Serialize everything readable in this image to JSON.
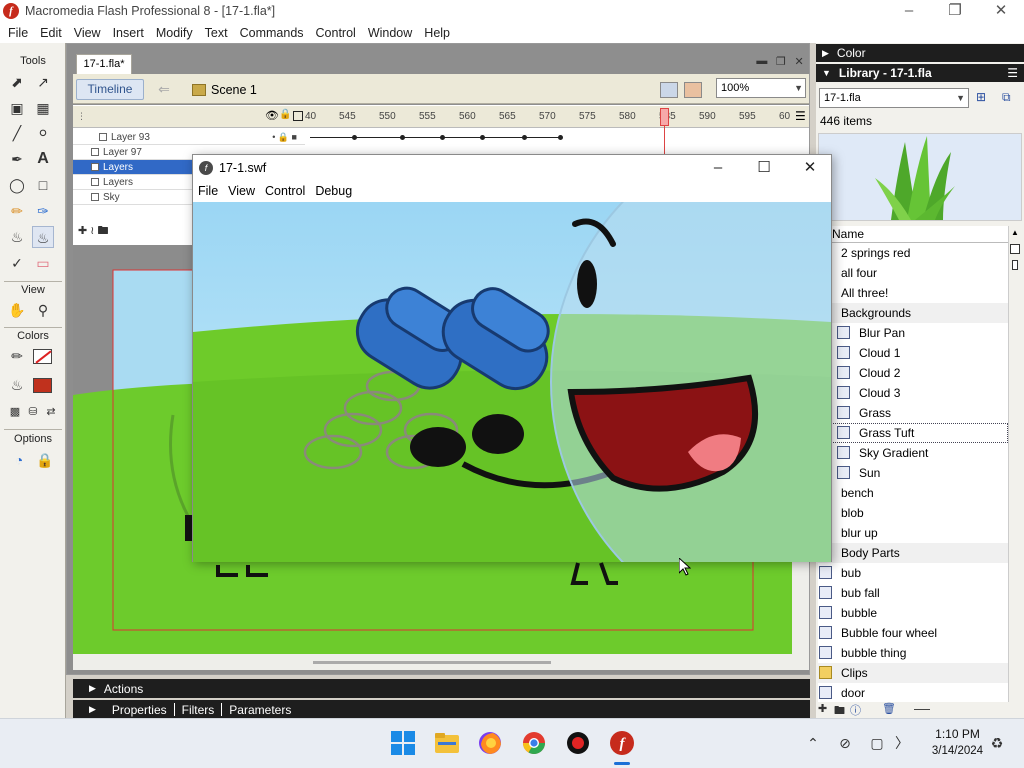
{
  "window": {
    "title": "Macromedia Flash Professional 8 - [17-1.fla*]"
  },
  "menubar": [
    "File",
    "Edit",
    "View",
    "Insert",
    "Modify",
    "Text",
    "Commands",
    "Control",
    "Window",
    "Help"
  ],
  "tools": {
    "tools_label": "Tools",
    "view_label": "View",
    "colors_label": "Colors",
    "options_label": "Options"
  },
  "document": {
    "tab": "17-1.fla*",
    "timeline_button": "Timeline",
    "scene": "Scene 1",
    "zoom": "100%"
  },
  "timeline": {
    "ruler": [
      "40",
      "545",
      "550",
      "555",
      "560",
      "565",
      "570",
      "575",
      "580",
      "585",
      "590",
      "595",
      "60"
    ],
    "layers": [
      "Layer 93",
      "Layer 97",
      "Layers",
      "Layers",
      "Sky"
    ],
    "selected_layer_index": 2
  },
  "panels": {
    "actions": "Actions",
    "properties": "Properties",
    "filters": "Filters",
    "parameters": "Parameters"
  },
  "right": {
    "color_header": "Color",
    "library_header": "Library - 17-1.fla",
    "library_select": "17-1.fla",
    "item_count": "446 items",
    "name_column": "Name"
  },
  "library_items": [
    {
      "name": "2 springs red",
      "kind": "symbol",
      "indent": 0
    },
    {
      "name": "all four",
      "kind": "symbol",
      "indent": 0
    },
    {
      "name": "All three!",
      "kind": "symbol",
      "indent": 0
    },
    {
      "name": "Backgrounds",
      "kind": "folder",
      "indent": 0
    },
    {
      "name": "Blur Pan",
      "kind": "symbol",
      "indent": 1
    },
    {
      "name": "Cloud 1",
      "kind": "symbol",
      "indent": 1
    },
    {
      "name": "Cloud 2",
      "kind": "symbol",
      "indent": 1
    },
    {
      "name": "Cloud 3",
      "kind": "symbol",
      "indent": 1
    },
    {
      "name": "Grass",
      "kind": "symbol",
      "indent": 1
    },
    {
      "name": "Grass Tuft",
      "kind": "symbol",
      "indent": 1
    },
    {
      "name": "Sky Gradient",
      "kind": "symbol",
      "indent": 1
    },
    {
      "name": "Sun",
      "kind": "symbol",
      "indent": 1
    },
    {
      "name": "bench",
      "kind": "symbol",
      "indent": 0
    },
    {
      "name": "blob",
      "kind": "symbol",
      "indent": 0
    },
    {
      "name": "blur up",
      "kind": "symbol",
      "indent": 0
    },
    {
      "name": "Body Parts",
      "kind": "folder",
      "indent": 0
    },
    {
      "name": "bub",
      "kind": "symbol",
      "indent": 0
    },
    {
      "name": "bub fall",
      "kind": "symbol",
      "indent": 0
    },
    {
      "name": "bubble",
      "kind": "symbol",
      "indent": 0
    },
    {
      "name": "Bubble four wheel",
      "kind": "symbol",
      "indent": 0
    },
    {
      "name": "bubble thing",
      "kind": "symbol",
      "indent": 0
    },
    {
      "name": "Clips",
      "kind": "folder",
      "indent": 0
    },
    {
      "name": "door",
      "kind": "symbol",
      "indent": 0
    }
  ],
  "highlighted_item": "Grass Tuft",
  "swf_window": {
    "title": "17-1.swf",
    "menu": [
      "File",
      "View",
      "Control",
      "Debug"
    ]
  },
  "taskbar": {
    "time": "1:10 PM",
    "date": "3/14/2024"
  },
  "colors": {
    "accent": "#3169c6",
    "flash_red": "#c62b1c",
    "grass": "#6fcf2a",
    "sky": "#a8dcf3"
  }
}
